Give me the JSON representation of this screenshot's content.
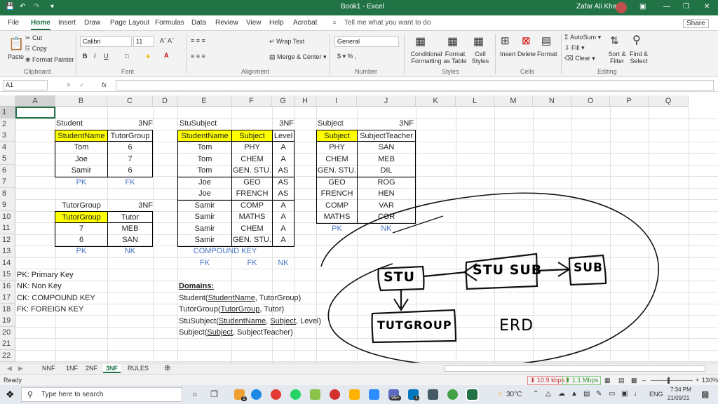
{
  "app": {
    "title": "Book1 - Excel",
    "user": "Zafar Ali Khan",
    "share": "Share",
    "tell_me": "Tell me what you want to do"
  },
  "menu": [
    "File",
    "Home",
    "Insert",
    "Draw",
    "Page Layout",
    "Formulas",
    "Data",
    "Review",
    "View",
    "Help",
    "Acrobat"
  ],
  "ribbon": {
    "cut": "Cut",
    "copy": "Copy",
    "format_painter": "Format Painter",
    "paste": "Paste",
    "clipboard": "Clipboard",
    "font_name": "Calibri",
    "font_size": "11",
    "font": "Font",
    "wrap": "Wrap Text",
    "merge": "Merge & Center",
    "alignment": "Alignment",
    "number_format": "General",
    "number": "Number",
    "cond": "Conditional Formatting",
    "fmt_table": "Format as Table",
    "cell_styles": "Cell Styles",
    "styles": "Styles",
    "insert": "Insert",
    "delete": "Delete",
    "format": "Format",
    "cells": "Cells",
    "autosum": "AutoSum",
    "fill": "Fill",
    "clear": "Clear",
    "sort": "Sort & Filter",
    "find": "Find & Select",
    "editing": "Editing"
  },
  "formula": {
    "namebox": "A1",
    "fx": "fx",
    "value": ""
  },
  "columns": [
    "A",
    "B",
    "C",
    "D",
    "E",
    "F",
    "G",
    "H",
    "I",
    "J",
    "K",
    "L",
    "M",
    "N",
    "O",
    "P",
    "Q"
  ],
  "rows": [
    "1",
    "2",
    "3",
    "4",
    "5",
    "6",
    "7",
    "8",
    "9",
    "10",
    "11",
    "12",
    "13",
    "14",
    "15",
    "16",
    "17",
    "18",
    "19",
    "20",
    "21",
    "22"
  ],
  "student": {
    "title": "Student",
    "nf": "3NF",
    "headers": [
      "StudentName",
      "TutorGroup"
    ],
    "rows": [
      [
        "Tom",
        "6"
      ],
      [
        "Joe",
        "7"
      ],
      [
        "Samir",
        "6"
      ]
    ],
    "keys": [
      "PK",
      "FK"
    ]
  },
  "tutor": {
    "title": "TutorGroup",
    "nf": "3NF",
    "headers": [
      "TutorGroup",
      "Tutor"
    ],
    "rows": [
      [
        "7",
        "MEB"
      ],
      [
        "6",
        "SAN"
      ]
    ],
    "keys": [
      "PK",
      "NK"
    ]
  },
  "stusubject": {
    "title": "StuSubject",
    "nf": "3NF",
    "headers": [
      "StudentName",
      "Subject",
      "Level"
    ],
    "rows": [
      [
        "Tom",
        "PHY",
        "A"
      ],
      [
        "Tom",
        "CHEM",
        "A"
      ],
      [
        "Tom",
        "GEN. STU.",
        "AS"
      ],
      [
        "Joe",
        "GEO",
        "AS"
      ],
      [
        "Joe",
        "FRENCH",
        "AS"
      ],
      [
        "Samir",
        "COMP",
        "A"
      ],
      [
        "Samir",
        "MATHS",
        "A"
      ],
      [
        "Samir",
        "CHEM",
        "A"
      ],
      [
        "Samir",
        "GEN. STU.",
        "A"
      ]
    ],
    "compound": "COMPOUND KEY",
    "keys": [
      "FK",
      "FK",
      "NK"
    ]
  },
  "subject": {
    "title": "Subject",
    "nf": "3NF",
    "headers": [
      "Subject",
      "SubjectTeacher"
    ],
    "rows": [
      [
        "PHY",
        "SAN"
      ],
      [
        "CHEM",
        "MEB"
      ],
      [
        "GEN. STU.",
        "DIL"
      ],
      [
        "GEO",
        "ROG"
      ],
      [
        "FRENCH",
        "HEN"
      ],
      [
        "COMP",
        "VAR"
      ],
      [
        "MATHS",
        "COR"
      ]
    ],
    "keys": [
      "PK",
      "NK"
    ]
  },
  "legend": [
    "PK: Primary Key",
    "NK: Non Key",
    "CK: COMPOUND KEY",
    "FK: FOREIGN KEY"
  ],
  "domains": {
    "title": "Domains:"
  },
  "erd": {
    "stu": "STU",
    "stusub": "STU SUB",
    "sub": "SUB",
    "tutgroup": "TUTGROUP",
    "label": "ERD"
  },
  "sheets": [
    "NNF",
    "1NF",
    "2NF",
    "3NF",
    "RULES"
  ],
  "status": {
    "ready": "Ready",
    "zoom": "130%",
    "down": "10.9 kbps",
    "up": "1.1 Mbps"
  },
  "taskbar": {
    "search": "Type here to search",
    "temp": "30°C",
    "lang": "ENG",
    "time": "7:34 PM",
    "date": "21/09/21",
    "badge1": "1",
    "badge2": "99+",
    "badge3": "1"
  },
  "colors": {
    "excel_green": "#217346",
    "key_yellow": "#ffff00",
    "key_blue": "#4472c4"
  }
}
